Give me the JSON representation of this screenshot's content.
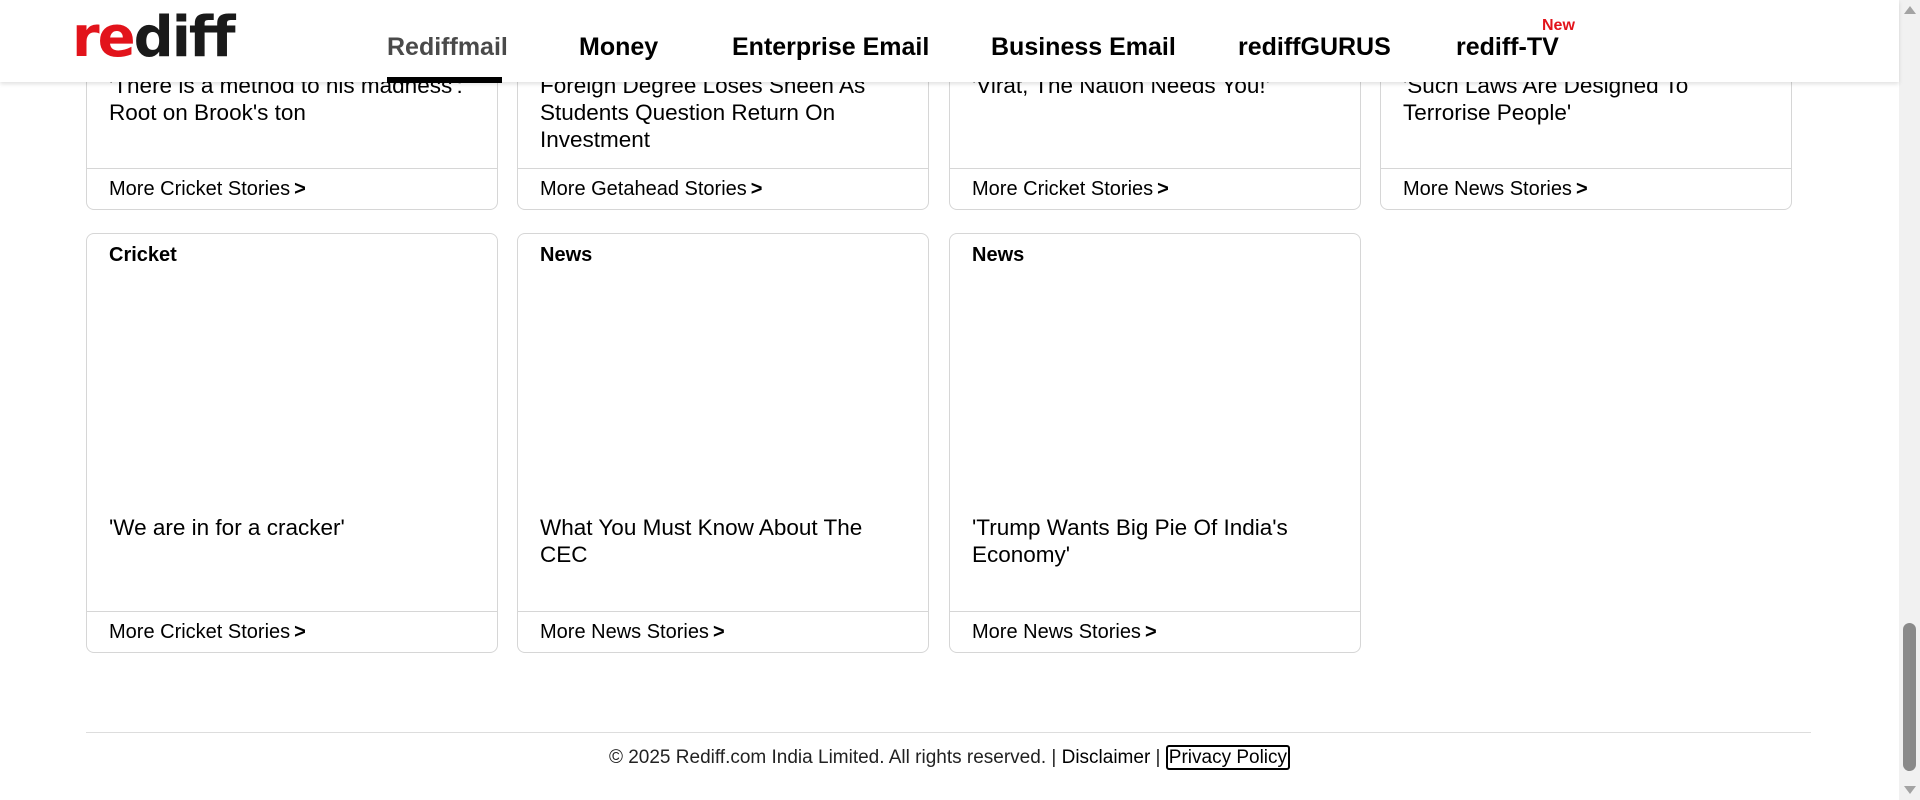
{
  "header": {
    "logo_left": "re",
    "logo_right": "diff",
    "nav": [
      {
        "label": "Rediffmail"
      },
      {
        "label": "Money"
      },
      {
        "label": "Enterprise Email"
      },
      {
        "label": "Business Email"
      },
      {
        "label": "rediffGURUS"
      },
      {
        "label": "rediff-TV"
      }
    ],
    "new_badge": "New",
    "brand_color": "#e2131b"
  },
  "cards_row1": [
    {
      "headline": "'There is a method to his madness': Root on Brook's ton",
      "more": "More Cricket Stories",
      "arrow": ">"
    },
    {
      "headline": "Foreign Degree Loses Sheen As Students Question Return On Investment",
      "more": "More Getahead Stories",
      "arrow": ">"
    },
    {
      "headline": "'Virat, The Nation Needs You!'",
      "more": "More Cricket Stories",
      "arrow": ">"
    },
    {
      "headline": "'Such Laws Are Designed To Terrorise People'",
      "more": "More News Stories",
      "arrow": ">"
    }
  ],
  "cards_row2": [
    {
      "category": "Cricket",
      "headline": "'We are in for a cracker'",
      "more": "More Cricket Stories",
      "arrow": ">"
    },
    {
      "category": "News",
      "headline": "What You Must Know About The CEC",
      "more": "More News Stories",
      "arrow": ">"
    },
    {
      "category": "News",
      "headline": "'Trump Wants Big Pie Of India's Economy'",
      "more": "More News Stories",
      "arrow": ">"
    }
  ],
  "footer": {
    "copyright": "© 2025 Rediff.com India Limited. All rights reserved. | ",
    "disclaimer": "Disclaimer",
    "separator": " | ",
    "privacy": "Privacy Policy"
  }
}
